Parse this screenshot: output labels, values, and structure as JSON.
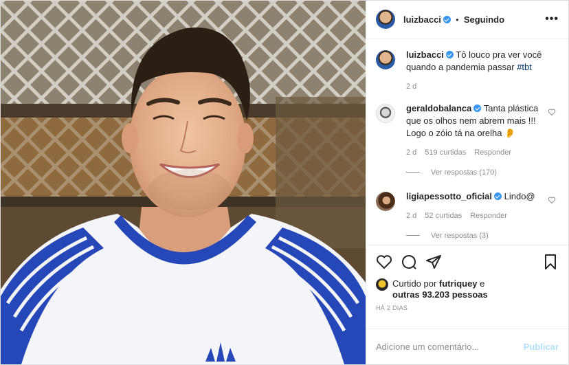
{
  "post": {
    "author": "luizbacci",
    "separator": "•",
    "follow_status": "Seguindo",
    "more_icon": "more-horizontal-icon"
  },
  "caption": {
    "user": "luizbacci",
    "text": "Tô louco pra ver você quando a pandemia passar ",
    "hashtag": "#tbt",
    "time": "2 d"
  },
  "comments": [
    {
      "user": "geraldobalanca",
      "text": "Tanta plástica que os olhos nem abrem mais !!! Logo o zóio tá na orelha 👂",
      "time": "2 d",
      "likes": "519 curtidas",
      "reply": "Responder",
      "view_replies": "Ver respostas (170)"
    },
    {
      "user": "ligiapessotto_oficial",
      "text": "Lindo@",
      "time": "2 d",
      "likes": "52 curtidas",
      "reply": "Responder",
      "view_replies": "Ver respostas (3)"
    }
  ],
  "likes": {
    "prefix": "Curtido por ",
    "user": "futriquey",
    "middle": " e",
    "others": "outras 93.203 pessoas"
  },
  "timestamp": "HÁ 2 DIAS",
  "add_comment": {
    "placeholder": "Adicione um comentário...",
    "publish": "Publicar"
  },
  "colors": {
    "verified": "#3897f0",
    "publish_disabled": "#b2dffc",
    "link": "#00376b",
    "muted": "#8e8e8e"
  }
}
